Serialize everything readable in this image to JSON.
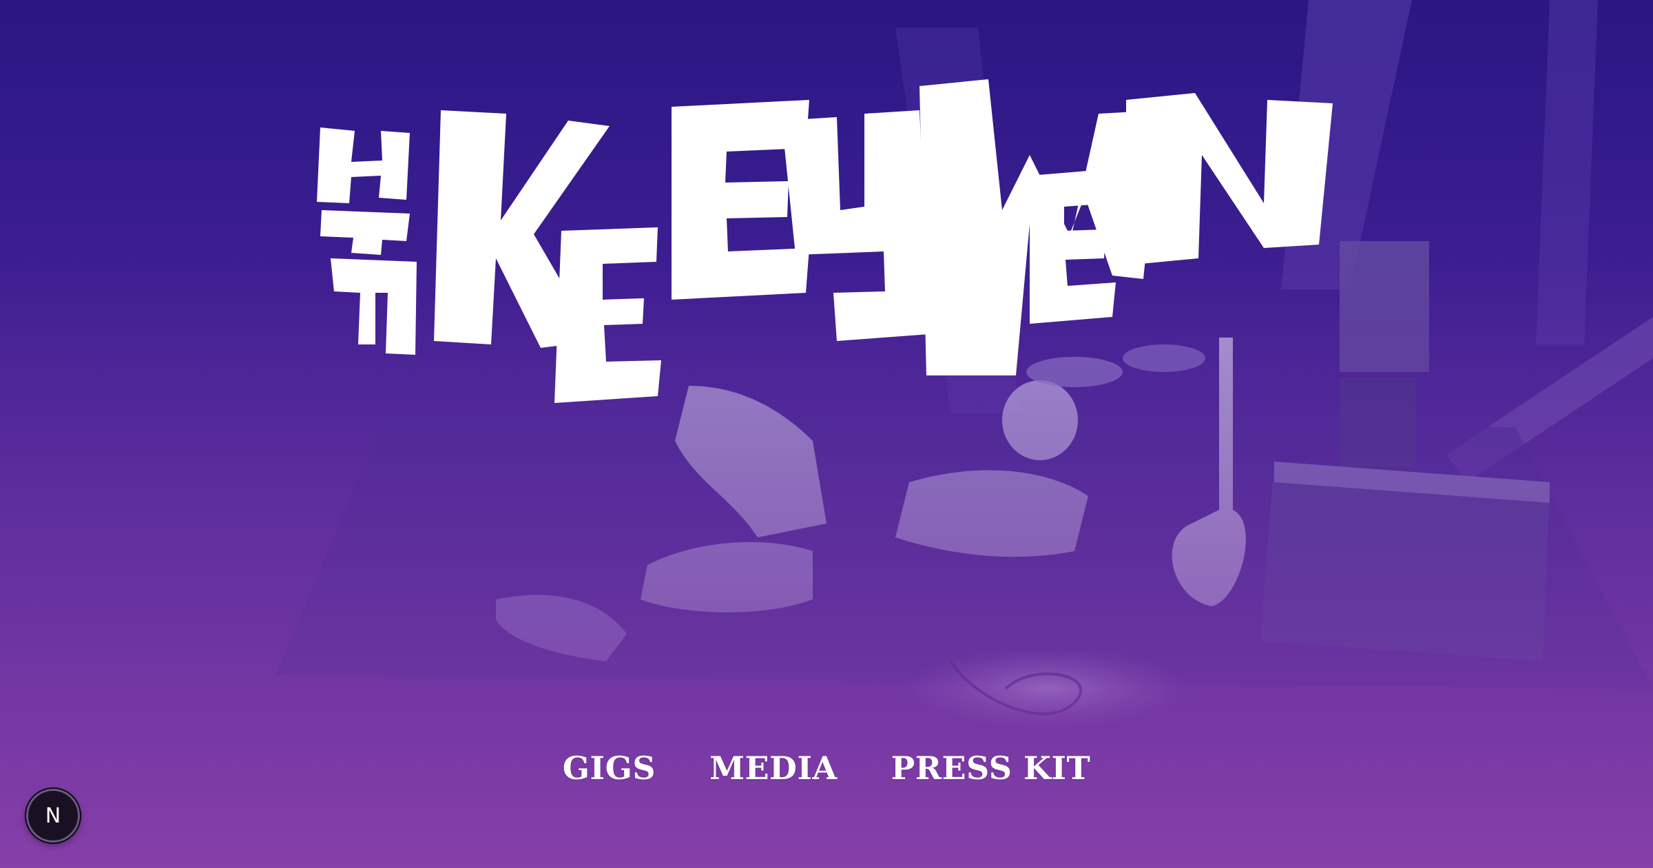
{
  "brand": {
    "logo_text": "THE KEEYMEN"
  },
  "nav": {
    "items": [
      {
        "label": "GIGS"
      },
      {
        "label": "MEDIA"
      },
      {
        "label": "PRESS KIT"
      }
    ]
  },
  "badge": {
    "label": "N",
    "icon": "n-logo-icon"
  },
  "colors": {
    "top": "#2a1783",
    "bottom": "#863fa9",
    "text": "#ffffff"
  }
}
